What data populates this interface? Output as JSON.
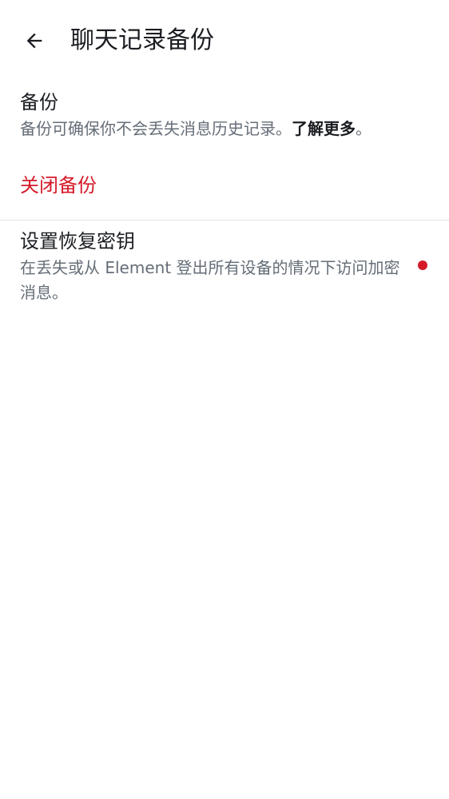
{
  "header": {
    "title": "聊天记录备份",
    "back_icon": "arrow-left-icon"
  },
  "backup": {
    "title": "备份",
    "description": "备份可确保你不会丢失消息历史记录。",
    "learn_more": "了解更多",
    "learn_more_suffix": "。",
    "turn_off_label": "关闭备份"
  },
  "recovery": {
    "title": "设置恢复密钥",
    "description": "在丢失或从 Element 登出所有设备的情况下访问加密消息。",
    "indicator": "red-dot-icon"
  },
  "colors": {
    "text_primary": "#1b1d22",
    "text_secondary": "#656d77",
    "critical": "#d51928",
    "divider": "#e1e4e8",
    "background": "#ffffff"
  }
}
